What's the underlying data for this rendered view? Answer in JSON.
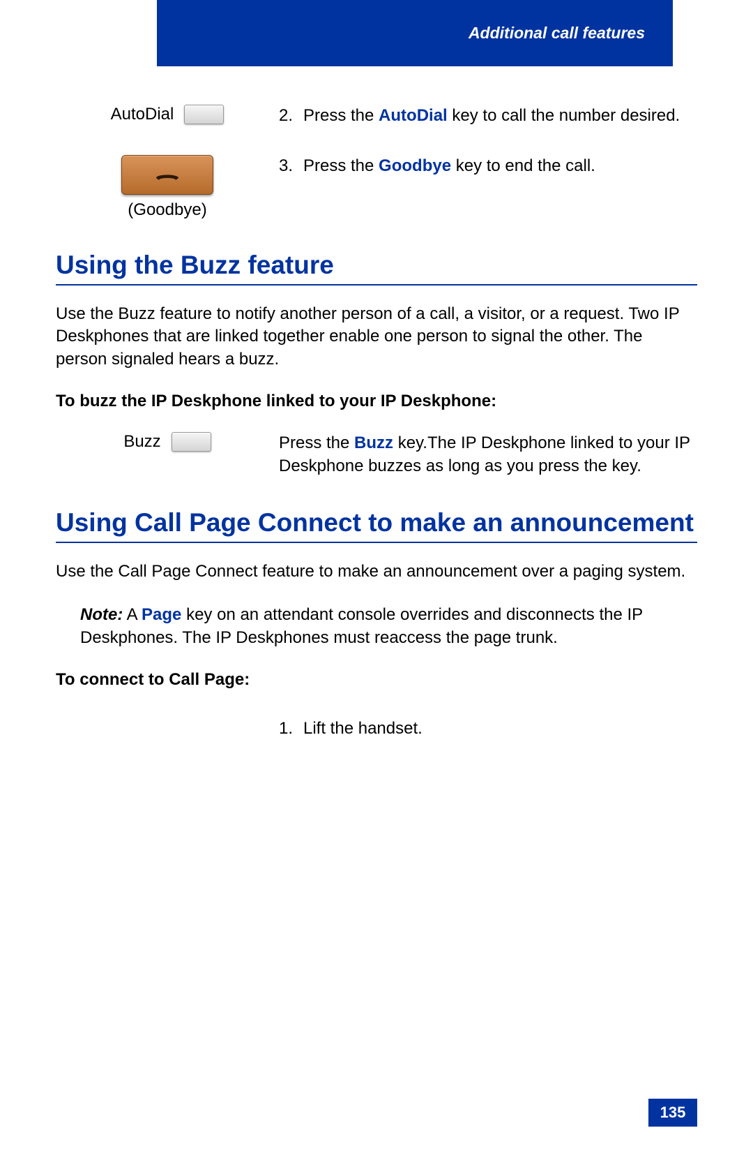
{
  "header": {
    "title": "Additional call features"
  },
  "top_steps": {
    "autodial": {
      "label": "AutoDial",
      "number": "2.",
      "text_before": "Press the ",
      "keyword": "AutoDial",
      "text_after": " key to call the number desired."
    },
    "goodbye": {
      "label": "(Goodbye)",
      "number": "3.",
      "text_before": "Press the ",
      "keyword": "Goodbye",
      "text_after": " key to end the call."
    }
  },
  "section_buzz": {
    "heading": "Using the Buzz feature",
    "intro": "Use the Buzz feature to notify another person of a call, a visitor, or a request. Two IP Deskphones that are linked together enable one person to signal the other. The person signaled hears a buzz.",
    "subhead": "To buzz the IP Deskphone linked to your IP Deskphone:",
    "key_label": "Buzz",
    "instr": {
      "text_before": "Press the ",
      "keyword": "Buzz",
      "text_after": " key.The IP Deskphone linked to your IP Deskphone buzzes as long as you press the key."
    }
  },
  "section_callpage": {
    "heading": "Using Call Page Connect to make an announcement",
    "intro": "Use the Call Page Connect feature to make an announcement over a paging system.",
    "note": {
      "label": "Note:",
      "text_before": " A ",
      "keyword": "Page",
      "text_after": " key on an attendant console overrides and disconnects the IP Deskphones. The IP Deskphones must reaccess the page trunk."
    },
    "subhead": "To connect to Call Page:",
    "step1": {
      "number": "1.",
      "text": "Lift the handset."
    }
  },
  "page_number": "135"
}
